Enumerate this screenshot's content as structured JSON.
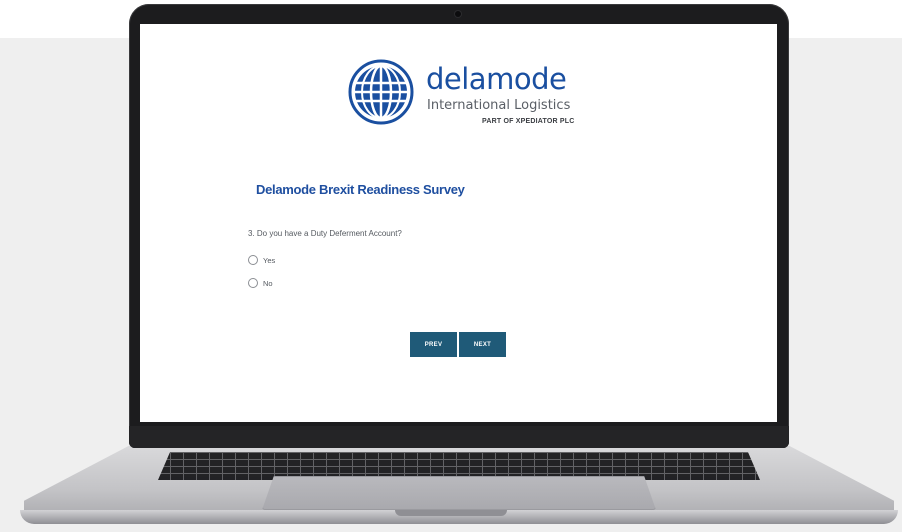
{
  "brand": {
    "name": "delamode",
    "subtitle": "International Logistics",
    "parent": "PART OF XPEDIATOR PLC",
    "color": "#1a4fa0"
  },
  "survey": {
    "title": "Delamode Brexit Readiness Survey",
    "question": "3. Do you have a Duty Deferment Account?",
    "options": [
      {
        "label": "Yes"
      },
      {
        "label": "No"
      }
    ]
  },
  "navigation": {
    "prev_label": "PREV",
    "next_label": "NEXT",
    "button_color": "#1f5a78"
  }
}
